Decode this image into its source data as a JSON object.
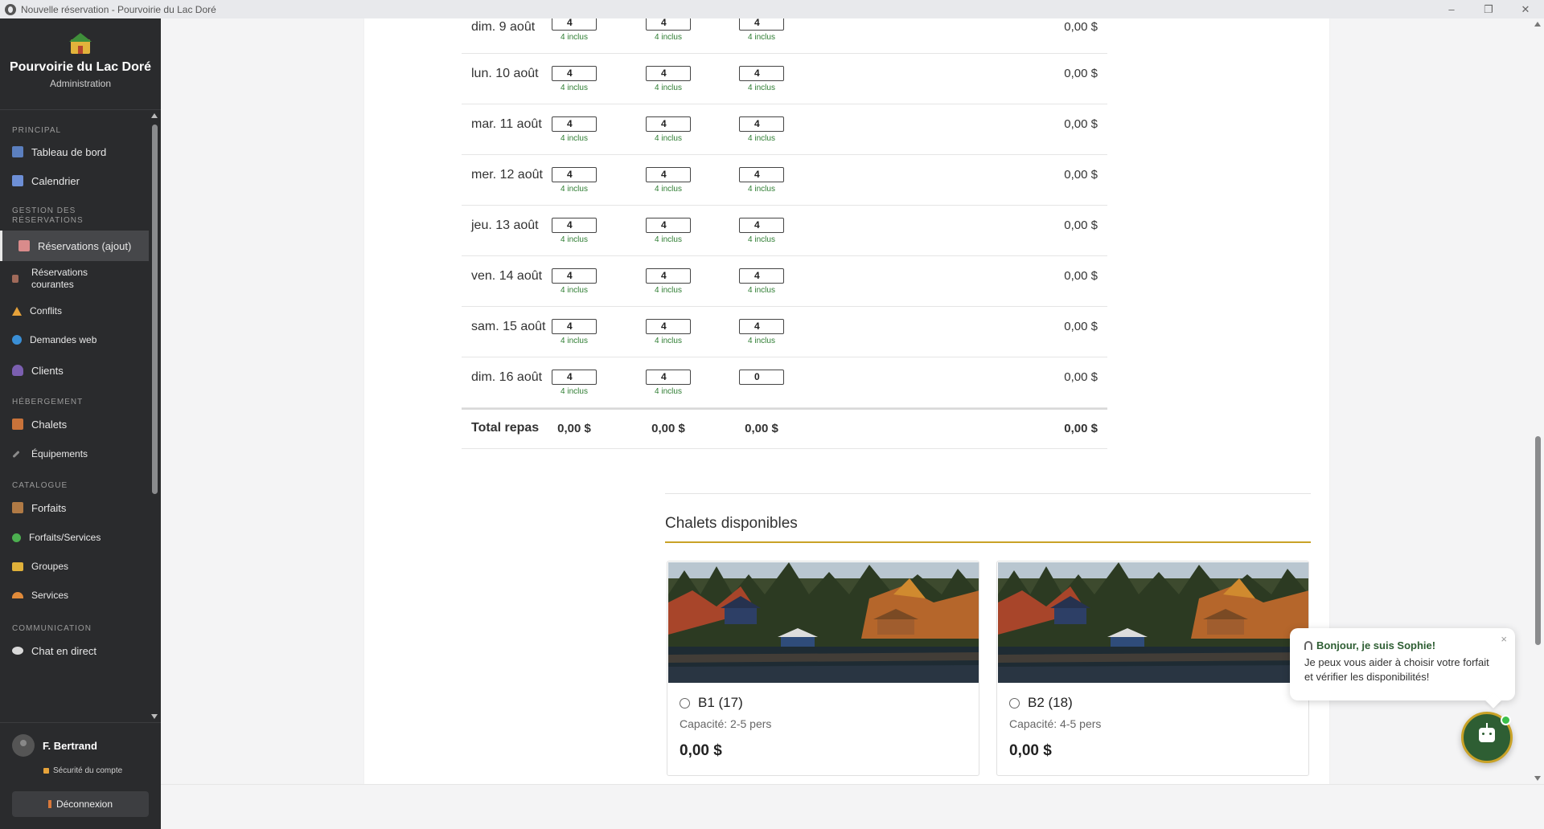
{
  "window": {
    "title": "Nouvelle réservation - Pourvoirie du Lac Doré",
    "minimize": "–",
    "restore": "❐",
    "close": "✕"
  },
  "brand": {
    "name": "Pourvoirie du Lac Doré",
    "subtitle": "Administration"
  },
  "nav": {
    "sections": {
      "principal": "PRINCIPAL",
      "gestion": "GESTION DES RÉSERVATIONS",
      "hebergement": "HÉBERGEMENT",
      "catalogue": "CATALOGUE",
      "communication": "COMMUNICATION"
    },
    "items": {
      "dashboard": "Tableau de bord",
      "calendar": "Calendrier",
      "reservations_add": "Réservations (ajout)",
      "reservations_current": "Réservations courantes",
      "conflicts": "Conflits",
      "web_requests": "Demandes web",
      "clients": "Clients",
      "chalets": "Chalets",
      "equipment": "Équipements",
      "packages": "Forfaits",
      "packages_services": "Forfaits/Services",
      "groups": "Groupes",
      "services": "Services",
      "live_chat": "Chat en direct"
    }
  },
  "user": {
    "name": "F. Bertrand",
    "security": "Sécurité du compte",
    "logout": "Déconnexion"
  },
  "meals": {
    "rows": [
      {
        "date": "dim. 9 août",
        "c1": "4",
        "c1_note": "4 inclus",
        "c2": "4",
        "c2_note": "4 inclus",
        "c3": "4",
        "c3_note": "4 inclus",
        "amount": "0,00 $"
      },
      {
        "date": "lun. 10 août",
        "c1": "4",
        "c1_note": "4 inclus",
        "c2": "4",
        "c2_note": "4 inclus",
        "c3": "4",
        "c3_note": "4 inclus",
        "amount": "0,00 $"
      },
      {
        "date": "mar. 11 août",
        "c1": "4",
        "c1_note": "4 inclus",
        "c2": "4",
        "c2_note": "4 inclus",
        "c3": "4",
        "c3_note": "4 inclus",
        "amount": "0,00 $"
      },
      {
        "date": "mer. 12 août",
        "c1": "4",
        "c1_note": "4 inclus",
        "c2": "4",
        "c2_note": "4 inclus",
        "c3": "4",
        "c3_note": "4 inclus",
        "amount": "0,00 $"
      },
      {
        "date": "jeu. 13 août",
        "c1": "4",
        "c1_note": "4 inclus",
        "c2": "4",
        "c2_note": "4 inclus",
        "c3": "4",
        "c3_note": "4 inclus",
        "amount": "0,00 $"
      },
      {
        "date": "ven. 14 août",
        "c1": "4",
        "c1_note": "4 inclus",
        "c2": "4",
        "c2_note": "4 inclus",
        "c3": "4",
        "c3_note": "4 inclus",
        "amount": "0,00 $"
      },
      {
        "date": "sam. 15 août",
        "c1": "4",
        "c1_note": "4 inclus",
        "c2": "4",
        "c2_note": "4 inclus",
        "c3": "4",
        "c3_note": "4 inclus",
        "amount": "0,00 $"
      },
      {
        "date": "dim. 16 août",
        "c1": "4",
        "c1_note": "4 inclus",
        "c2": "4",
        "c2_note": "4 inclus",
        "c3": "0",
        "c3_note": "",
        "amount": "0,00 $"
      }
    ],
    "total": {
      "label": "Total repas",
      "t1": "0,00 $",
      "t2": "0,00 $",
      "t3": "0,00 $",
      "amount": "0,00 $"
    }
  },
  "chalets": {
    "title": "Chalets disponibles",
    "cards": [
      {
        "name": "B1 (17)",
        "capacity": "Capacité: 2-5 pers",
        "price": "0,00 $"
      },
      {
        "name": "B2 (18)",
        "capacity": "Capacité: 4-5 pers",
        "price": "0,00 $"
      }
    ]
  },
  "chat": {
    "greeting": "Bonjour, je suis Sophie!",
    "message": "Je peux vous aider à choisir votre forfait et vérifier les disponibilités!",
    "close": "×"
  },
  "colors": {
    "sidebar": "#2a2b2d",
    "accent_gold": "#c9a227",
    "chat_green": "#2e5e33",
    "included_green": "#2e7d32"
  }
}
